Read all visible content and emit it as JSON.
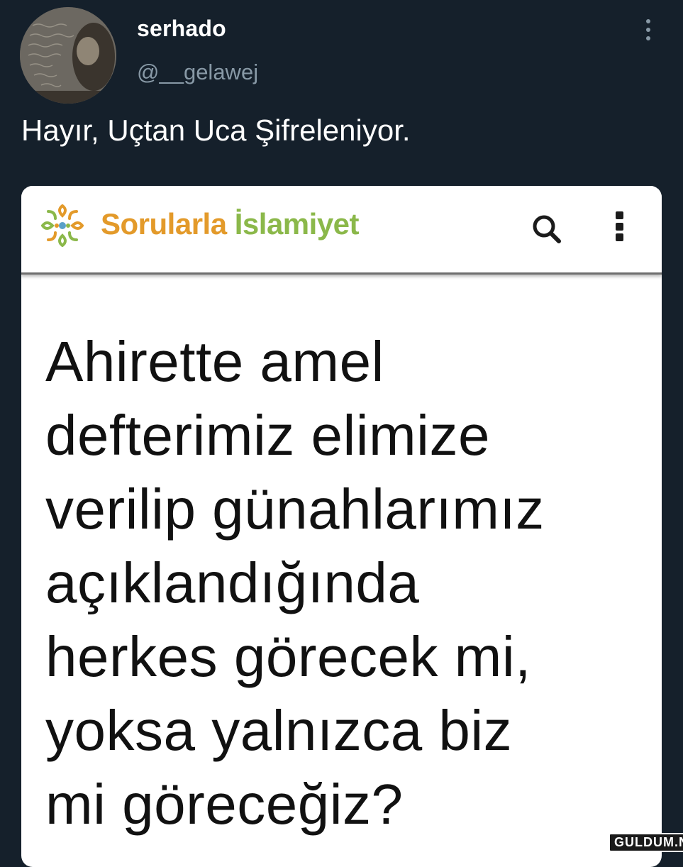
{
  "tweet": {
    "display_name": "serhado",
    "handle": "@__gelawej",
    "text": "Hayır, Uçtan Uca Şifreleniyor."
  },
  "card": {
    "site_name_part1": "Sorularla ",
    "site_name_part2": "İslamiyet",
    "question": "Ahirette amel\ndefterimiz elimize\nverilip günahlarımız\naçıklandığında\nherkes görecek mi,\nyoksa yalnızca biz\nmi göreceğiz?",
    "colors": {
      "site_orange": "#e39a2a",
      "site_green": "#8bb84a"
    }
  },
  "watermark": "GULDUM.NET",
  "icons": {
    "tweet_menu": "vertical-ellipsis-icon",
    "site_logo": "flower-logo-icon",
    "search": "search-icon",
    "site_menu": "kebab-menu-icon"
  },
  "theme": {
    "background": "#15202b",
    "secondary_text": "#8899a6"
  }
}
